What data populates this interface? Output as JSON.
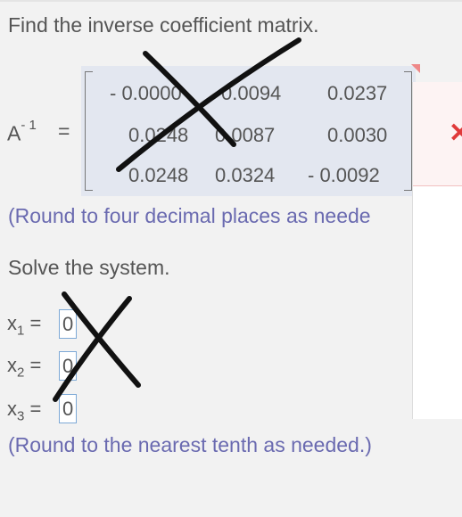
{
  "question": {
    "inverse_prompt": "Find the inverse coefficient matrix.",
    "matrix_symbol": "A",
    "matrix_superscript": "- 1",
    "equals": "=",
    "matrix": [
      [
        "- 0.0000",
        "0.0094",
        "0.0237"
      ],
      [
        "0.0248",
        "0.0087",
        "0.0030"
      ],
      [
        "0.0248",
        "0.0324",
        "- 0.0092"
      ]
    ],
    "round_hint_1": "(Round to four decimal places as neede",
    "solve_prompt": "Solve the system.",
    "round_hint_2": "(Round to the nearest tenth as needed.)"
  },
  "solution": {
    "vars": [
      {
        "name": "x",
        "sub": "1",
        "value": "0"
      },
      {
        "name": "x",
        "sub": "2",
        "value": "0"
      },
      {
        "name": "x",
        "sub": "3",
        "value": "0"
      }
    ]
  },
  "popup": {
    "close_icon": "✕"
  },
  "colors": {
    "hint": "#6a6ab0",
    "input_border": "#7da9d6",
    "matrix_bg": "#e3e7f0",
    "popup_x": "#e03a3a"
  }
}
